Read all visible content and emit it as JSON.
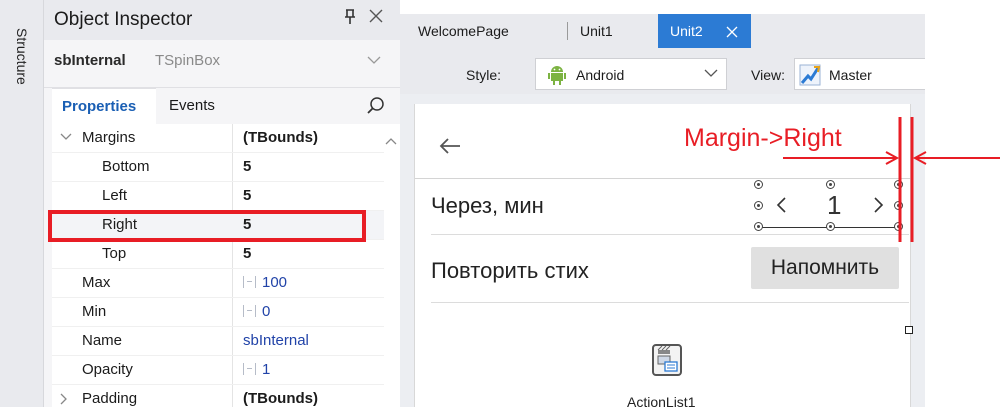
{
  "structure_panel": {
    "label": "Structure"
  },
  "object_inspector": {
    "title": "Object Inspector",
    "pin_glyph": "¤",
    "selected_component": {
      "name": "sbInternal",
      "type": "TSpinBox"
    },
    "tabs": {
      "properties": "Properties",
      "events": "Events"
    },
    "properties": [
      {
        "name": "Margins",
        "value": "(TBounds)",
        "expanded": true,
        "value_style": "bold"
      },
      {
        "name": "Bottom",
        "value": "5",
        "value_style": "bold"
      },
      {
        "name": "Left",
        "value": "5",
        "value_style": "bold"
      },
      {
        "name": "Right",
        "value": "5",
        "value_style": "bold",
        "highlighted": true
      },
      {
        "name": "Top",
        "value": "5",
        "value_style": "bold"
      },
      {
        "name": "Max",
        "value": "100",
        "value_style": "blue"
      },
      {
        "name": "Min",
        "value": "0",
        "value_style": "blue"
      },
      {
        "name": "Name",
        "value": "sbInternal",
        "value_style": "blue"
      },
      {
        "name": "Opacity",
        "value": "1",
        "value_style": "blue"
      },
      {
        "name": "Padding",
        "value": "(TBounds)",
        "expanded": false,
        "value_style": "bold"
      }
    ]
  },
  "editor": {
    "tabs": [
      {
        "label": "WelcomePage",
        "active": false
      },
      {
        "label": "Unit1",
        "active": false
      },
      {
        "label": "Unit2",
        "active": true
      }
    ],
    "toolbar": {
      "style_label": "Style:",
      "style_value": "Android",
      "view_label": "View:",
      "view_value": "Master"
    }
  },
  "form": {
    "label_cherez": "Через, мин",
    "spinbox_value": "1",
    "label_povtorit": "Повторить стих",
    "button_napomnit": "Напомнить",
    "action_list_label": "ActionList1"
  },
  "annotation": {
    "text": "Margin->Right",
    "color": "#e81d25"
  },
  "colors": {
    "accent_blue": "#2c7bd4",
    "properties_tab_text": "#1a5fb4",
    "value_blue": "#2143a8",
    "annotation_red": "#e81d25"
  }
}
